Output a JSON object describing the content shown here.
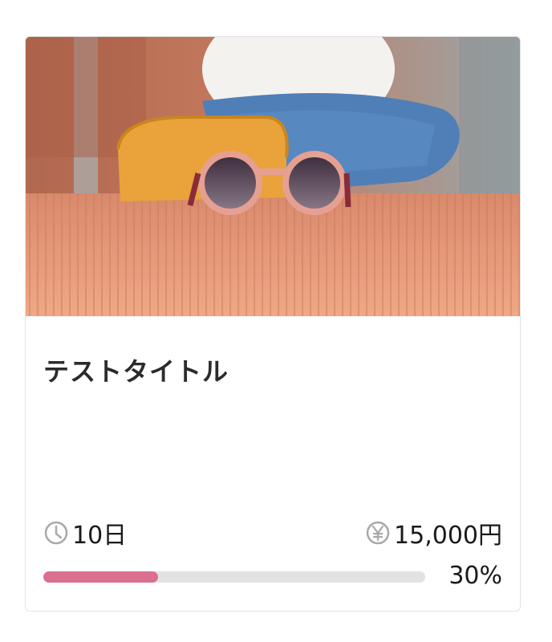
{
  "card": {
    "image_alt": "sunglasses on orange bench",
    "title": "テストタイトル",
    "days_icon": "clock-icon",
    "days_text": "10日",
    "price_icon": "yen-circle-icon",
    "price_text": "15,000円",
    "progress_fraction": 0.3,
    "progress_text": "30%",
    "colors": {
      "progress_fill": "#d9708f",
      "progress_track": "#e1e3e3"
    }
  }
}
